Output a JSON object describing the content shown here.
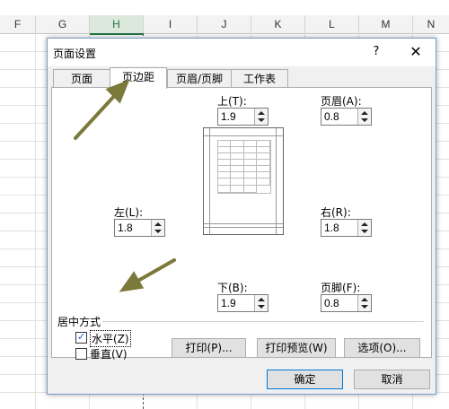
{
  "spreadsheet": {
    "columns": [
      "F",
      "G",
      "H",
      "I",
      "J",
      "K",
      "L",
      "M",
      "N"
    ],
    "selected_column": "H"
  },
  "dialog": {
    "title": "页面设置",
    "help": "?",
    "close": "✕",
    "tabs": [
      "页面",
      "页边距",
      "页眉/页脚",
      "工作表"
    ],
    "active_tab": "页边距",
    "margins": {
      "top": {
        "label": "上(T):",
        "value": "1.9"
      },
      "header": {
        "label": "页眉(A):",
        "value": "0.8"
      },
      "left": {
        "label": "左(L):",
        "value": "1.8"
      },
      "right": {
        "label": "右(R):",
        "value": "1.8"
      },
      "bottom": {
        "label": "下(B):",
        "value": "1.9"
      },
      "footer": {
        "label": "页脚(F):",
        "value": "0.8"
      }
    },
    "center": {
      "title": "居中方式",
      "horizontal": {
        "label": "水平(Z)",
        "checked": true
      },
      "vertical": {
        "label": "垂直(V)",
        "checked": false
      }
    },
    "buttons": {
      "print": "打印(P)...",
      "print_preview": "打印预览(W)",
      "options": "选项(O)...",
      "ok": "确定",
      "cancel": "取消"
    }
  },
  "annotation_color": "#7b7a3a"
}
